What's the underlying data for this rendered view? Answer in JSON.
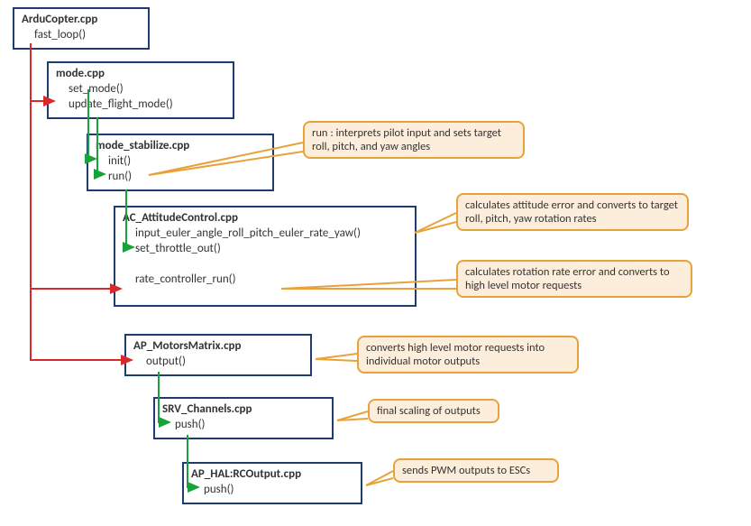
{
  "boxes": {
    "arducopter": {
      "title": "ArduCopter.cpp",
      "fns": [
        "fast_loop()"
      ]
    },
    "mode": {
      "title": "mode.cpp",
      "fns": [
        "set_mode()",
        "update_flight_mode()"
      ]
    },
    "mode_stabilize": {
      "title": "mode_stabilize.cpp",
      "fns": [
        "init()",
        "run()"
      ]
    },
    "ac_attitude": {
      "title": "AC_AttitudeControl.cpp",
      "fns": [
        "input_euler_angle_roll_pitch_euler_rate_yaw()",
        "set_throttle_out()",
        "",
        "rate_controller_run()"
      ]
    },
    "motors": {
      "title": "AP_MotorsMatrix.cpp",
      "fns": [
        "output()"
      ]
    },
    "srv": {
      "title": "SRV_Channels.cpp",
      "fns": [
        "push()"
      ]
    },
    "hal": {
      "title": "AP_HAL:RCOutput.cpp",
      "fns": [
        "push()"
      ]
    }
  },
  "callouts": {
    "run_desc": "run : interprets pilot input and sets target roll, pitch, and yaw angles",
    "input_euler_desc": "calculates attitude error and converts to target roll, pitch, yaw rotation rates",
    "rate_ctrl_desc": "calculates rotation rate error and converts to high level motor requests",
    "motors_desc": "converts high level motor requests into individual motor outputs",
    "srv_desc": "final scaling of outputs",
    "hal_desc": "sends PWM outputs to ESCs"
  }
}
